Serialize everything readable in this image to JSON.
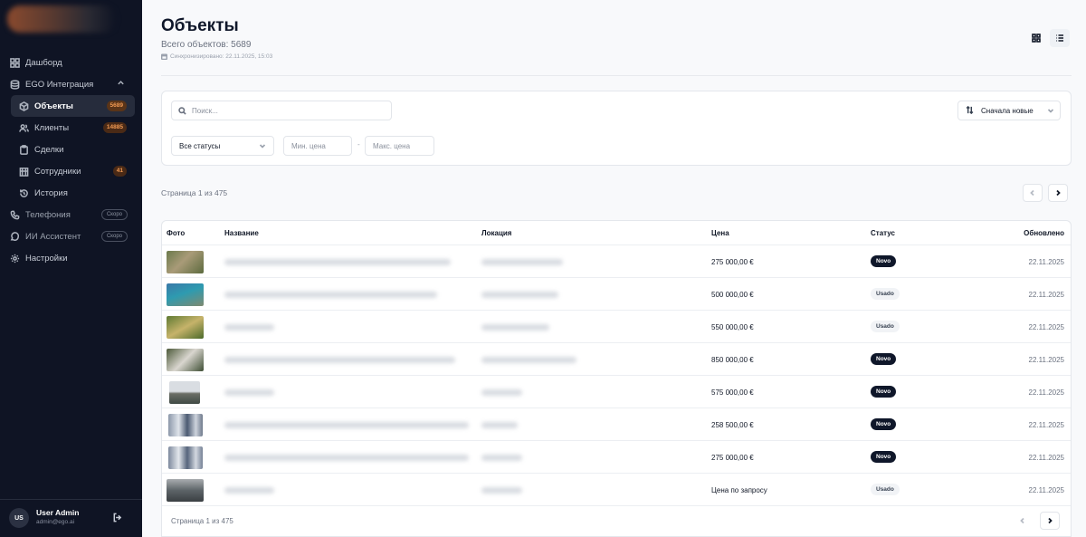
{
  "sidebar": {
    "items": [
      {
        "label": "Дашборд",
        "icon": "dashboard-icon"
      },
      {
        "label": "EGO Интеграция",
        "icon": "database-icon"
      },
      {
        "label": "Объекты",
        "icon": "box-icon",
        "badge": "5689"
      },
      {
        "label": "Клиенты",
        "icon": "users-icon",
        "badge": "14885"
      },
      {
        "label": "Сделки",
        "icon": "clipboard-icon"
      },
      {
        "label": "Сотрудники",
        "icon": "building-icon",
        "badge": "41"
      },
      {
        "label": "История",
        "icon": "history-icon"
      },
      {
        "label": "Телефония",
        "icon": "phone-icon",
        "tag": "Скоро"
      },
      {
        "label": "ИИ Ассистент",
        "icon": "bot-icon",
        "tag": "Скоро"
      },
      {
        "label": "Настройки",
        "icon": "gear-icon"
      }
    ],
    "user": {
      "initials": "US",
      "name": "User Admin",
      "email": "admin@ego.ai"
    }
  },
  "header": {
    "title": "Объекты",
    "total": "Всего объектов: 5689",
    "sync": "Синхронизировано: 22.11.2025, 15:03"
  },
  "filters": {
    "search_placeholder": "Поиск...",
    "sort_label": "Сначала новые",
    "status_label": "Все статусы",
    "min_price_placeholder": "Мин. цена",
    "max_price_placeholder": "Макс. цена",
    "range_separator": "-"
  },
  "pagination": {
    "label": "Страница 1 из 475"
  },
  "table": {
    "columns": {
      "photo": "Фото",
      "name": "Название",
      "location": "Локация",
      "price": "Цена",
      "status": "Статус",
      "updated": "Обновлено"
    },
    "rows": [
      {
        "price": "275 000,00 €",
        "status": "Novo",
        "updated": "22.11.2025"
      },
      {
        "price": "500 000,00 €",
        "status": "Usado",
        "updated": "22.11.2025"
      },
      {
        "price": "550 000,00 €",
        "status": "Usado",
        "updated": "22.11.2025"
      },
      {
        "price": "850 000,00 €",
        "status": "Novo",
        "updated": "22.11.2025"
      },
      {
        "price": "575 000,00 €",
        "status": "Novo",
        "updated": "22.11.2025"
      },
      {
        "price": "258 500,00 €",
        "status": "Novo",
        "updated": "22.11.2025"
      },
      {
        "price": "275 000,00 €",
        "status": "Novo",
        "updated": "22.11.2025"
      },
      {
        "price": "Цена по запросу",
        "status": "Usado",
        "updated": "22.11.2025"
      }
    ]
  },
  "colors": {
    "sidebar_bg": "#0f1424",
    "accent_badge": "#f19a54",
    "novo_pill": "#0f172a",
    "usado_pill": "#f1f3f6"
  }
}
